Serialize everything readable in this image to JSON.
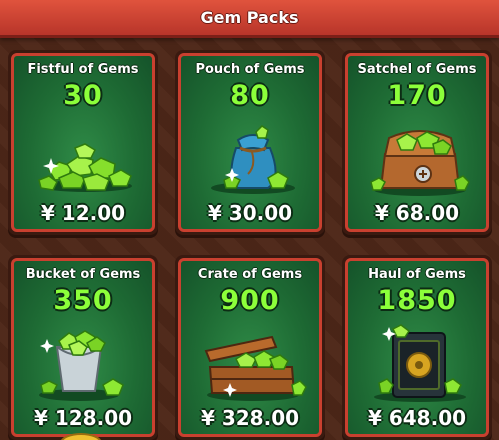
{
  "header": {
    "title": "Gem Packs"
  },
  "packs": [
    {
      "name": "Fistful of Gems",
      "amount": "30",
      "price": "¥ 12.00",
      "icon": "gem-pile-icon"
    },
    {
      "name": "Pouch of Gems",
      "amount": "80",
      "price": "¥ 30.00",
      "icon": "gem-pouch-icon"
    },
    {
      "name": "Satchel of Gems",
      "amount": "170",
      "price": "¥ 68.00",
      "icon": "gem-satchel-icon"
    },
    {
      "name": "Bucket of Gems",
      "amount": "350",
      "price": "¥ 128.00",
      "icon": "gem-bucket-icon"
    },
    {
      "name": "Crate of Gems",
      "amount": "900",
      "price": "¥ 328.00",
      "icon": "gem-crate-icon"
    },
    {
      "name": "Haul of Gems",
      "amount": "1850",
      "price": "¥ 648.00",
      "icon": "gem-safe-icon"
    }
  ],
  "colors": {
    "header": "#c9402f",
    "card_bg": "#1e6b34",
    "amount_text": "#8cff3a",
    "gem": "#7ee02a"
  }
}
